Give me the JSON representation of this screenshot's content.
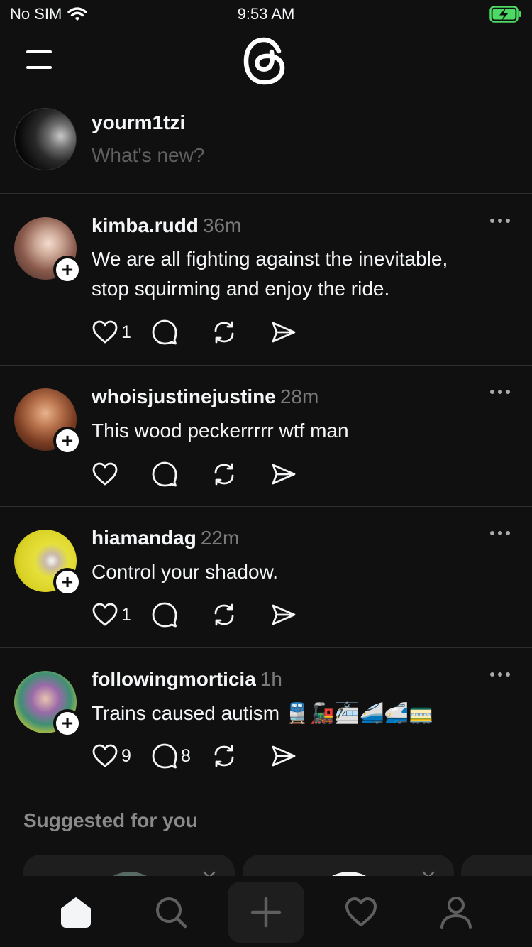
{
  "status_bar": {
    "carrier": "No SIM",
    "time": "9:53 AM"
  },
  "composer": {
    "username": "yourm1tzi",
    "placeholder": "What's new?"
  },
  "posts": [
    {
      "username": "kimba.rudd",
      "time": "36m",
      "text": "We are all fighting against the inevitable,\nstop squirming and enjoy the ride.",
      "likes": "1",
      "replies": ""
    },
    {
      "username": "whoisjustinejustine",
      "time": "28m",
      "text": "This wood peckerrrrr wtf man",
      "likes": "",
      "replies": ""
    },
    {
      "username": "hiamandag",
      "time": "22m",
      "text": "Control your shadow.",
      "likes": "1",
      "replies": ""
    },
    {
      "username": "followingmorticia",
      "time": "1h",
      "text": "Trains caused autism 🚆🚂🚈🚄🚅🚃",
      "likes": "9",
      "replies": "8"
    }
  ],
  "suggested": {
    "title": "Suggested for you"
  },
  "icons": {
    "menu": "menu-icon",
    "logo": "threads-logo",
    "more": "more-icon",
    "like": "heart-icon",
    "reply": "comment-icon",
    "repost": "repost-icon",
    "share": "send-icon",
    "tabs": [
      "home-icon",
      "search-icon",
      "plus-icon",
      "heart-icon",
      "profile-icon"
    ]
  },
  "colors": {
    "background": "#101010",
    "text": "#f3f5f7",
    "muted": "#7a7a7a",
    "battery": "#4cd964"
  }
}
